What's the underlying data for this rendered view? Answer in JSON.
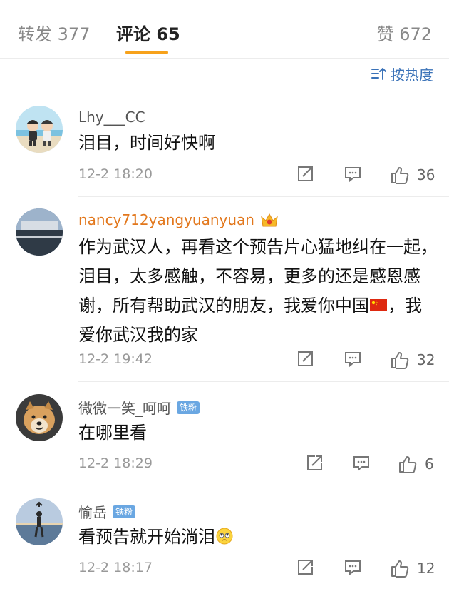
{
  "tabs": {
    "repost": "转发 377",
    "comments": "评论 65",
    "likes": "赞 672"
  },
  "sort": {
    "label": "按热度"
  },
  "comments": [
    {
      "user": "Lhy___CC",
      "text": "泪目，时间好快啊",
      "time": "12-2 18:20",
      "likes": "36"
    },
    {
      "user": "nancy712yangyuanyuan",
      "text_before_flag": "作为武汉人，再看这个预告片心猛地纠在一起，泪目，太多感触，不容易，更多的还是感恩感谢，所有帮助武汉的朋友，我爱你中国",
      "text_after_flag": "，我爱你武汉我的家",
      "time": "12-2 19:42",
      "likes": "32"
    },
    {
      "user": "微微一笑_呵呵",
      "badge": "铁粉",
      "text": "在哪里看",
      "time": "12-2 18:29",
      "likes": "6"
    },
    {
      "user": "愉岳",
      "badge": "铁粉",
      "text": "看预告就开始淌泪",
      "time": "12-2 18:17",
      "likes": "12"
    }
  ],
  "colors": {
    "accent": "#f7a21b",
    "link": "#3a72b8",
    "vip_name": "#e2771c",
    "badge": "#6aa7e2"
  }
}
